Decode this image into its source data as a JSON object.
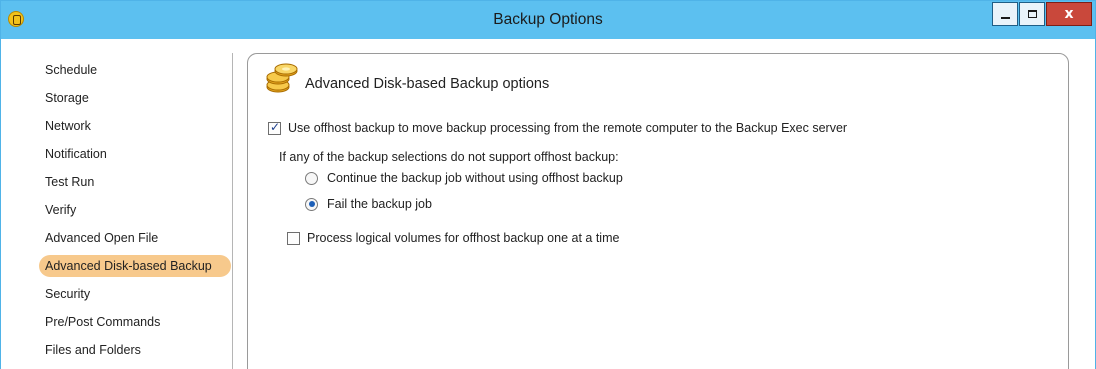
{
  "window": {
    "title": "Backup Options",
    "close_glyph": "x",
    "accent_color": "#5cc0f0"
  },
  "sidebar": {
    "items": [
      {
        "label": "Schedule"
      },
      {
        "label": "Storage"
      },
      {
        "label": "Network"
      },
      {
        "label": "Notification"
      },
      {
        "label": "Test Run"
      },
      {
        "label": "Verify"
      },
      {
        "label": "Advanced Open File"
      },
      {
        "label": "Advanced Disk-based Backup",
        "selected": true
      },
      {
        "label": "Security"
      },
      {
        "label": "Pre/Post Commands"
      },
      {
        "label": "Files and Folders"
      }
    ],
    "selected_color": "#f7c98c"
  },
  "panel": {
    "title": "Advanced Disk-based Backup options",
    "icon": "stacked-disks-icon",
    "offhost_checkbox": {
      "label": "Use offhost backup to move backup processing from the remote computer to the Backup Exec server",
      "checked": true
    },
    "unsupported_prompt": "If any of the backup selections do not support offhost backup:",
    "radio_continue": {
      "label": "Continue the backup job without using offhost backup",
      "selected": false
    },
    "radio_fail": {
      "label": "Fail the backup job",
      "selected": true
    },
    "logical_volumes_checkbox": {
      "label": "Process logical volumes for offhost backup one at a time",
      "checked": false
    }
  }
}
